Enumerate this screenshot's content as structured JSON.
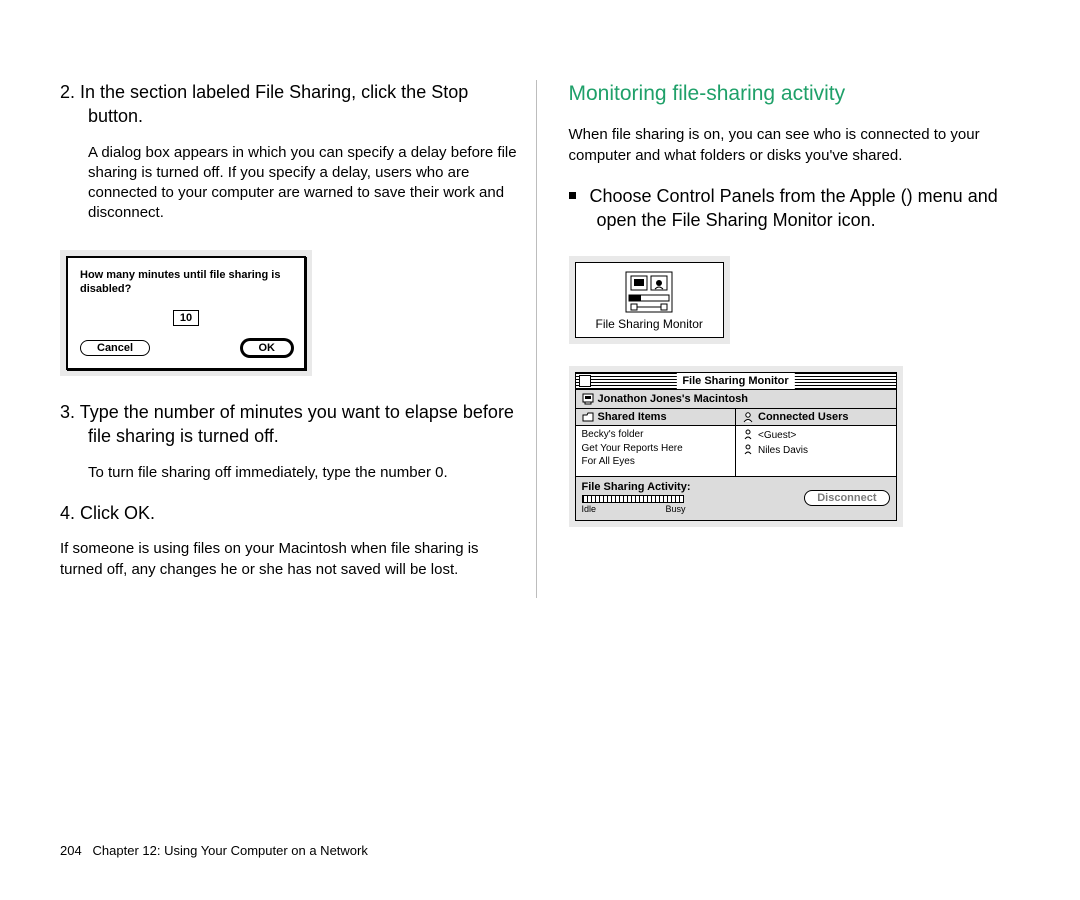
{
  "left": {
    "step2_num": "2. ",
    "step2_text": "In the section labeled File Sharing, click the Stop button.",
    "step2_body": "A dialog box appears in which you can specify a delay before file sharing is turned off. If you specify a delay, users who are connected to your computer are warned to save their work and disconnect.",
    "dialog": {
      "question": "How many minutes until file sharing is disabled?",
      "value": "10",
      "cancel": "Cancel",
      "ok": "OK"
    },
    "step3_num": "3. ",
    "step3_text": "Type the number of minutes you want to elapse before file sharing is turned off.",
    "step3_body": "To turn file sharing off immediately, type the number 0.",
    "step4_num": "4. ",
    "step4_text": "Click OK.",
    "step4_body": "If someone is using files on your Macintosh when file sharing is turned off, any changes he or she has not saved will be lost."
  },
  "right": {
    "title": "Monitoring file-sharing activity",
    "intro": "When file sharing is on, you can see who is connected to your computer and what folders or disks you've shared.",
    "bullet_pre": "Choose Control Panels from the Apple (",
    "bullet_post": ") menu and open the File Sharing Monitor icon.",
    "icon_label": "File Sharing Monitor",
    "window": {
      "title": "File Sharing Monitor",
      "owner": "Jonathon Jones's Macintosh",
      "shared_header": "Shared Items",
      "users_header": "Connected Users",
      "shared_items": [
        "Becky's folder",
        "Get Your Reports Here",
        "For All Eyes"
      ],
      "users": [
        "<Guest>",
        "Niles Davis"
      ],
      "activity_label": "File Sharing Activity:",
      "idle": "Idle",
      "busy": "Busy",
      "disconnect": "Disconnect"
    }
  },
  "footer": {
    "page_no": "204",
    "chapter": "Chapter 12: Using Your Computer on a Network"
  }
}
